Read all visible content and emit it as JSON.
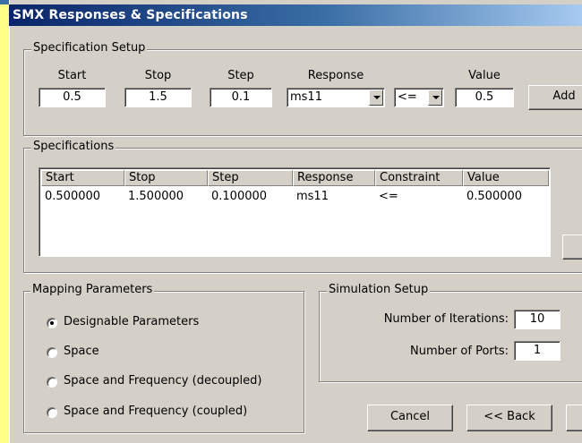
{
  "window": {
    "title": "SMX Responses & Specifications"
  },
  "spec_setup": {
    "legend": "Specification Setup",
    "labels": {
      "start": "Start",
      "stop": "Stop",
      "step": "Step",
      "response": "Response",
      "value": "Value"
    },
    "start": "0.5",
    "stop": "1.5",
    "step": "0.1",
    "response": "ms11",
    "constraint": "<=",
    "value": "0.5",
    "add_button": "Add"
  },
  "specifications": {
    "legend": "Specifications",
    "columns": [
      "Start",
      "Stop",
      "Step",
      "Response",
      "Constraint",
      "Value"
    ],
    "rows": [
      [
        "0.500000",
        "1.500000",
        "0.100000",
        "ms11",
        "<=",
        "0.500000"
      ]
    ]
  },
  "mapping": {
    "legend": "Mapping Parameters",
    "options": [
      {
        "label": "Designable Parameters",
        "selected": true
      },
      {
        "label": "Space",
        "selected": false
      },
      {
        "label": "Space and Frequency (decoupled)",
        "selected": false
      },
      {
        "label": "Space and Frequency (coupled)",
        "selected": false
      }
    ]
  },
  "simulation": {
    "legend": "Simulation Setup",
    "iterations_label": "Number of Iterations:",
    "iterations": "10",
    "ports_label": "Number of Ports:",
    "ports": "1"
  },
  "buttons": {
    "cancel": "Cancel",
    "back": "<< Back"
  }
}
